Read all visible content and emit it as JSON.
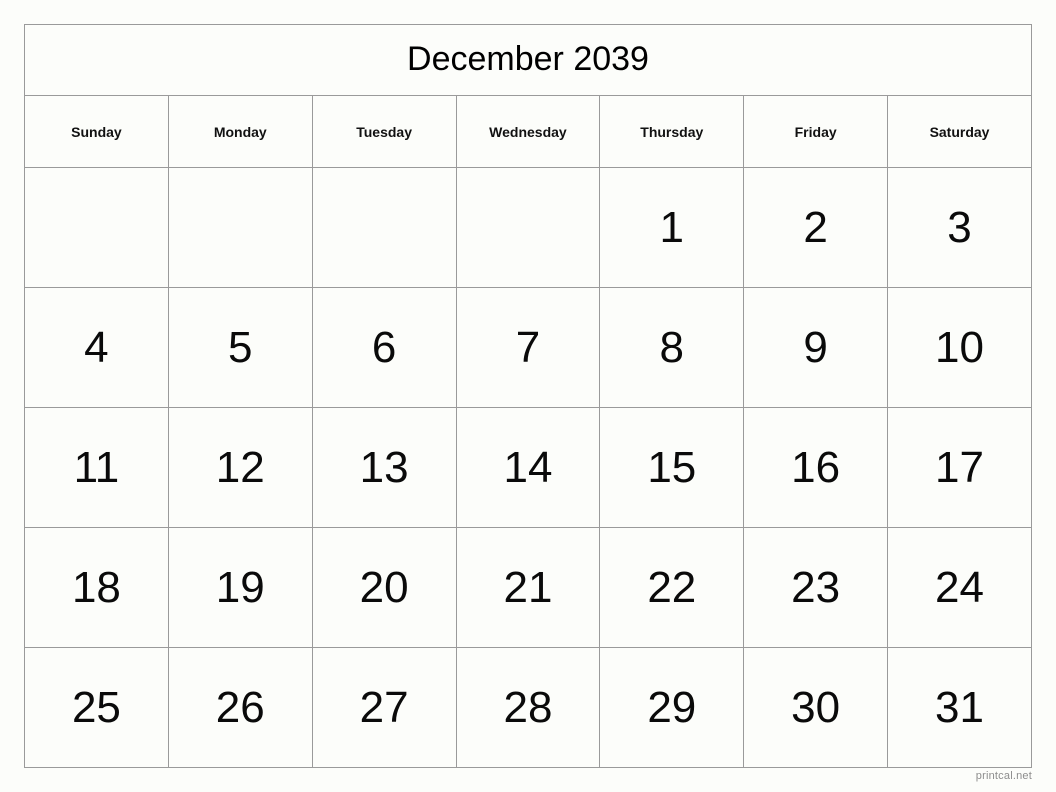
{
  "calendar": {
    "title": "December 2039",
    "month": "December",
    "year": "2039",
    "weekday_headers": [
      "Sunday",
      "Monday",
      "Tuesday",
      "Wednesday",
      "Thursday",
      "Friday",
      "Saturday"
    ],
    "weeks": [
      [
        "",
        "",
        "",
        "",
        "1",
        "2",
        "3"
      ],
      [
        "4",
        "5",
        "6",
        "7",
        "8",
        "9",
        "10"
      ],
      [
        "11",
        "12",
        "13",
        "14",
        "15",
        "16",
        "17"
      ],
      [
        "18",
        "19",
        "20",
        "21",
        "22",
        "23",
        "24"
      ],
      [
        "25",
        "26",
        "27",
        "28",
        "29",
        "30",
        "31"
      ]
    ]
  },
  "footer": {
    "source": "printcal.net"
  },
  "colors": {
    "page_background": "#fcfdfa",
    "grid_line": "#9a9a9a",
    "text": "#0a0a0a",
    "footer_text": "#8d8d8d"
  }
}
